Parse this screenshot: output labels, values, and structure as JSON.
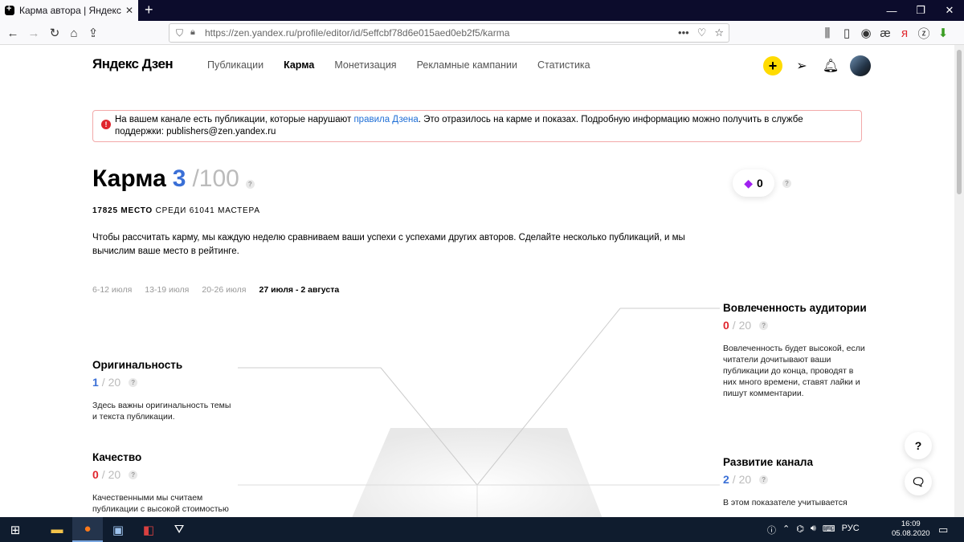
{
  "browser": {
    "tab_title": "Карма автора | Яндекс Дзен",
    "tab_close": "✕",
    "newtab": "+",
    "window_controls": [
      "—",
      "❐",
      "✕"
    ],
    "url": "https://zen.yandex.ru/profile/editor/id/5effcbf78d6e015aed0eb2f5/karma",
    "url_actions": [
      "•••",
      "♡",
      "☆"
    ]
  },
  "header": {
    "logo": "Яндекс Дзен",
    "nav": [
      "Публикации",
      "Карма",
      "Монетизация",
      "Рекламные кампании",
      "Статистика"
    ],
    "active_nav": "Карма"
  },
  "alert": {
    "text_before": "На вашем канале есть публикации, которые нарушают ",
    "link": "правила Дзена",
    "text_after": ". Это отразилось на карме и показах. Подробную информацию можно получить в службе поддержки: publishers@zen.yandex.ru"
  },
  "karma": {
    "label": "Карма",
    "value": "3",
    "max": "/100",
    "rank_place": "17825 МЕСТО",
    "rank_rest": "СРЕДИ 61041 МАСТЕРА",
    "description": "Чтобы рассчитать карму, мы каждую неделю сравниваем ваши успехи с успехами других авторов. Сделайте несколько публикаций, и мы вычислим ваше место в рейтинге.",
    "weeks": [
      "6-12 июля",
      "13-19 июля",
      "20-26 июля",
      "27 июля - 2 августа"
    ],
    "current_week": "27 июля - 2 августа",
    "points": "0"
  },
  "metrics": {
    "originality": {
      "title": "Оригинальность",
      "value": "1",
      "max": "/ 20",
      "desc": "Здесь важны оригинальность темы и текста публикации."
    },
    "quality": {
      "title": "Качество",
      "value": "0",
      "max": "/ 20",
      "desc": "Качественными мы считаем публикации с высокой стоимостью"
    },
    "engagement": {
      "title": "Вовлеченность аудитории",
      "value": "0",
      "max": "/ 20",
      "desc": "Вовлеченность будет высокой, если читатели дочитывают ваши публикации до конца, проводят в них много времени, ставят лайки и пишут комментарии."
    },
    "growth": {
      "title": "Развитие канала",
      "value": "2",
      "max": "/ 20",
      "desc": "В этом показателе учитывается"
    }
  },
  "taskbar": {
    "lang": "РУС",
    "time": "16:09",
    "date": "05.08.2020"
  },
  "colors": {
    "accent_blue": "#3a6fd6",
    "error_red": "#e0262e",
    "brand_yellow": "#ffdb00"
  }
}
